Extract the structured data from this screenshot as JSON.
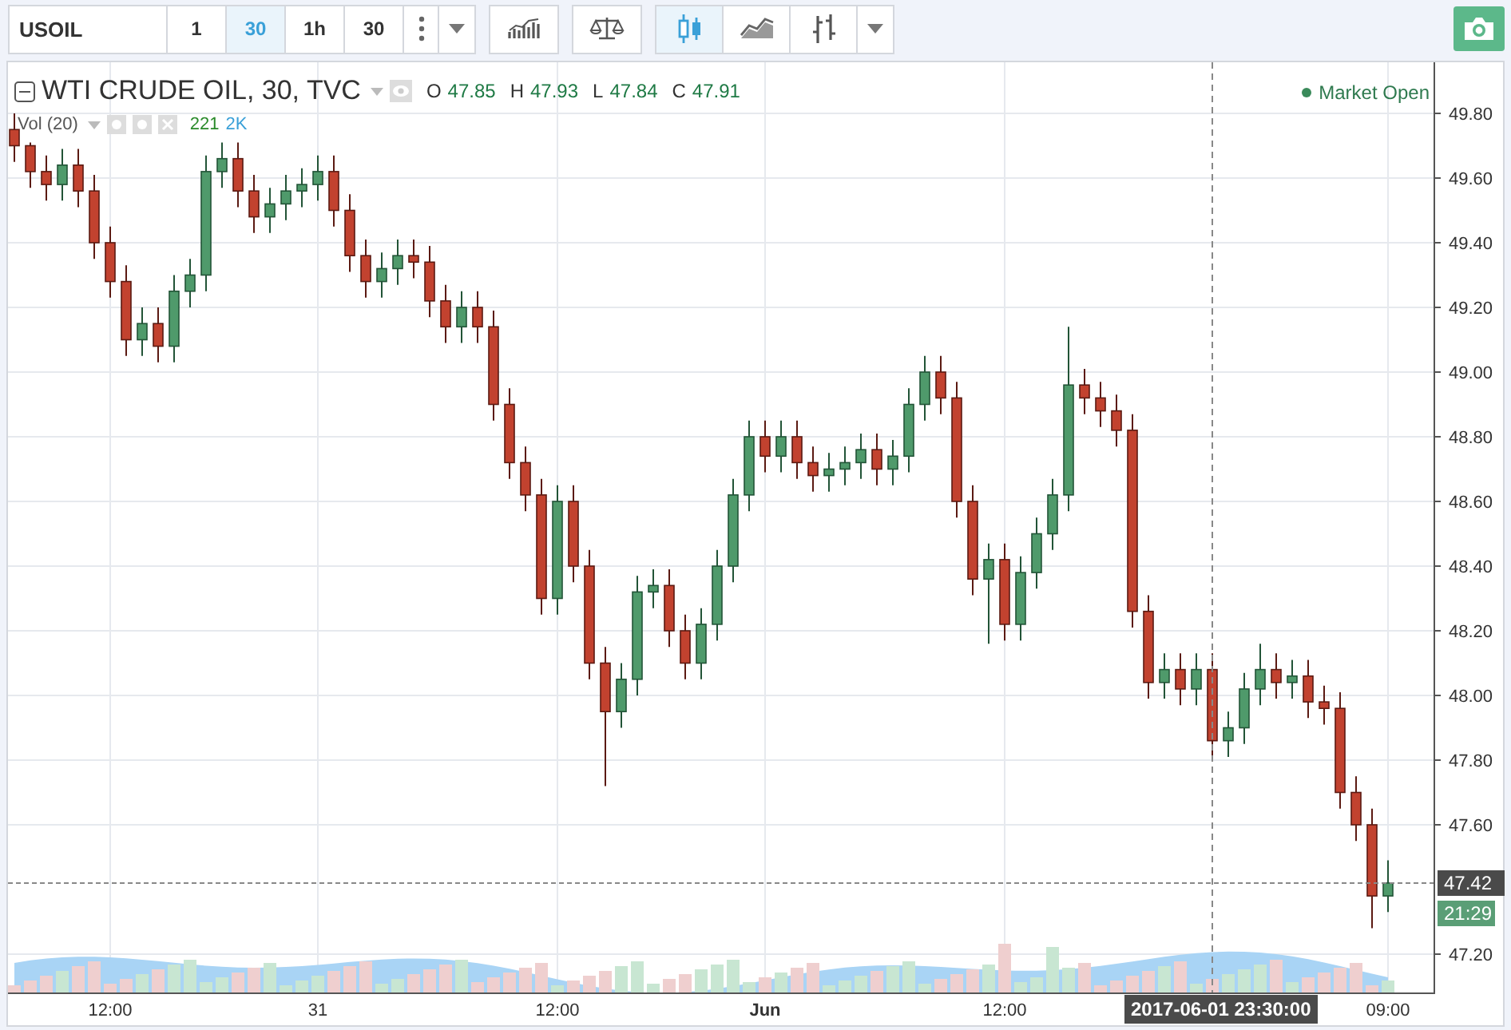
{
  "toolbar": {
    "symbol": "USOIL",
    "intervals": [
      {
        "label": "1",
        "selected": false
      },
      {
        "label": "30",
        "selected": true
      },
      {
        "label": "1h",
        "selected": false
      },
      {
        "label": "30",
        "selected": false
      }
    ],
    "chart_types": [
      {
        "kind": "candles",
        "selected": true
      },
      {
        "kind": "area",
        "selected": false
      },
      {
        "kind": "bars",
        "selected": false
      }
    ]
  },
  "legend": {
    "title": "WTI CRUDE OIL, 30, TVC",
    "ohlc": [
      {
        "label": "O",
        "value": "47.85"
      },
      {
        "label": "H",
        "value": "47.93"
      },
      {
        "label": "L",
        "value": "47.84"
      },
      {
        "label": "C",
        "value": "47.91"
      }
    ],
    "status": "Market Open",
    "volume": {
      "label": "Vol (20)",
      "value": "221",
      "average": "2K"
    }
  },
  "chart": {
    "last_price": "47.42",
    "countdown": "21:29",
    "crosshair_time": "2017-06-01 23:30:00",
    "chart_data": {
      "type": "candlestick",
      "categories": [
        null,
        null,
        null,
        null,
        null,
        null,
        "12:00",
        null,
        null,
        null,
        null,
        null,
        null,
        null,
        null,
        null,
        null,
        null,
        null,
        "31",
        null,
        null,
        null,
        null,
        null,
        null,
        null,
        null,
        null,
        null,
        null,
        null,
        null,
        null,
        "12:00",
        null,
        null,
        null,
        null,
        null,
        null,
        null,
        null,
        null,
        null,
        null,
        null,
        "Jun",
        null,
        null,
        null,
        null,
        null,
        null,
        null,
        null,
        null,
        null,
        null,
        null,
        null,
        null,
        "12:00",
        null,
        null,
        null,
        null,
        null,
        null,
        null,
        null,
        null,
        null,
        null,
        null,
        null,
        null,
        null,
        null,
        null,
        null,
        null,
        null,
        null,
        null,
        null,
        "09:00"
      ],
      "ohlc": [
        [
          49.75,
          49.8,
          49.65,
          49.7
        ],
        [
          49.7,
          49.71,
          49.57,
          49.62
        ],
        [
          49.62,
          49.67,
          49.53,
          49.58
        ],
        [
          49.58,
          49.69,
          49.53,
          49.64
        ],
        [
          49.64,
          49.69,
          49.51,
          49.56
        ],
        [
          49.56,
          49.61,
          49.35,
          49.4
        ],
        [
          49.4,
          49.45,
          49.23,
          49.28
        ],
        [
          49.28,
          49.33,
          49.05,
          49.1
        ],
        [
          49.1,
          49.2,
          49.05,
          49.15
        ],
        [
          49.15,
          49.2,
          49.03,
          49.08
        ],
        [
          49.08,
          49.3,
          49.03,
          49.25
        ],
        [
          49.25,
          49.35,
          49.2,
          49.3
        ],
        [
          49.3,
          49.67,
          49.25,
          49.62
        ],
        [
          49.62,
          49.71,
          49.57,
          49.66
        ],
        [
          49.66,
          49.71,
          49.51,
          49.56
        ],
        [
          49.56,
          49.61,
          49.43,
          49.48
        ],
        [
          49.48,
          49.57,
          49.43,
          49.52
        ],
        [
          49.52,
          49.61,
          49.47,
          49.56
        ],
        [
          49.56,
          49.63,
          49.51,
          49.58
        ],
        [
          49.58,
          49.67,
          49.53,
          49.62
        ],
        [
          49.62,
          49.67,
          49.45,
          49.5
        ],
        [
          49.5,
          49.55,
          49.31,
          49.36
        ],
        [
          49.36,
          49.41,
          49.23,
          49.28
        ],
        [
          49.28,
          49.37,
          49.23,
          49.32
        ],
        [
          49.32,
          49.41,
          49.27,
          49.36
        ],
        [
          49.36,
          49.41,
          49.29,
          49.34
        ],
        [
          49.34,
          49.39,
          49.17,
          49.22
        ],
        [
          49.22,
          49.27,
          49.09,
          49.14
        ],
        [
          49.14,
          49.25,
          49.09,
          49.2
        ],
        [
          49.2,
          49.25,
          49.09,
          49.14
        ],
        [
          49.14,
          49.19,
          48.85,
          48.9
        ],
        [
          48.9,
          48.95,
          48.67,
          48.72
        ],
        [
          48.72,
          48.77,
          48.57,
          48.62
        ],
        [
          48.62,
          48.67,
          48.25,
          48.3
        ],
        [
          48.3,
          48.65,
          48.25,
          48.6
        ],
        [
          48.6,
          48.65,
          48.35,
          48.4
        ],
        [
          48.4,
          48.45,
          48.05,
          48.1
        ],
        [
          48.1,
          48.15,
          47.72,
          47.95
        ],
        [
          47.95,
          48.1,
          47.9,
          48.05
        ],
        [
          48.05,
          48.37,
          48.0,
          48.32
        ],
        [
          48.32,
          48.39,
          48.27,
          48.34
        ],
        [
          48.34,
          48.39,
          48.15,
          48.2
        ],
        [
          48.2,
          48.25,
          48.05,
          48.1
        ],
        [
          48.1,
          48.27,
          48.05,
          48.22
        ],
        [
          48.22,
          48.45,
          48.17,
          48.4
        ],
        [
          48.4,
          48.67,
          48.35,
          48.62
        ],
        [
          48.62,
          48.85,
          48.57,
          48.8
        ],
        [
          48.8,
          48.85,
          48.69,
          48.74
        ],
        [
          48.74,
          48.85,
          48.69,
          48.8
        ],
        [
          48.8,
          48.85,
          48.67,
          48.72
        ],
        [
          48.72,
          48.77,
          48.63,
          48.68
        ],
        [
          48.68,
          48.75,
          48.63,
          48.7
        ],
        [
          48.7,
          48.77,
          48.65,
          48.72
        ],
        [
          48.72,
          48.81,
          48.67,
          48.76
        ],
        [
          48.76,
          48.81,
          48.65,
          48.7
        ],
        [
          48.7,
          48.79,
          48.65,
          48.74
        ],
        [
          48.74,
          48.95,
          48.69,
          48.9
        ],
        [
          48.9,
          49.05,
          48.85,
          49.0
        ],
        [
          49.0,
          49.05,
          48.87,
          48.92
        ],
        [
          48.92,
          48.97,
          48.55,
          48.6
        ],
        [
          48.6,
          48.65,
          48.31,
          48.36
        ],
        [
          48.36,
          48.47,
          48.16,
          48.42
        ],
        [
          48.42,
          48.47,
          48.17,
          48.22
        ],
        [
          48.22,
          48.43,
          48.17,
          48.38
        ],
        [
          48.38,
          48.55,
          48.33,
          48.5
        ],
        [
          48.5,
          48.67,
          48.45,
          48.62
        ],
        [
          48.62,
          49.14,
          48.57,
          48.96
        ],
        [
          48.96,
          49.01,
          48.87,
          48.92
        ],
        [
          48.92,
          48.97,
          48.83,
          48.88
        ],
        [
          48.88,
          48.93,
          48.77,
          48.82
        ],
        [
          48.82,
          48.87,
          48.21,
          48.26
        ],
        [
          48.26,
          48.31,
          47.99,
          48.04
        ],
        [
          48.04,
          48.13,
          47.99,
          48.08
        ],
        [
          48.08,
          48.13,
          47.97,
          48.02
        ],
        [
          48.02,
          48.13,
          47.97,
          48.08
        ],
        [
          48.08,
          48.13,
          47.81,
          47.86
        ],
        [
          47.86,
          47.95,
          47.81,
          47.9
        ],
        [
          47.9,
          48.07,
          47.85,
          48.02
        ],
        [
          48.02,
          48.16,
          47.97,
          48.08
        ],
        [
          48.08,
          48.13,
          47.99,
          48.04
        ],
        [
          48.04,
          48.11,
          47.99,
          48.06
        ],
        [
          48.06,
          48.11,
          47.93,
          47.98
        ],
        [
          47.98,
          48.03,
          47.91,
          47.96
        ],
        [
          47.96,
          48.01,
          47.65,
          47.7
        ],
        [
          47.7,
          47.75,
          47.55,
          47.6
        ],
        [
          47.6,
          47.65,
          47.28,
          47.38
        ],
        [
          47.38,
          47.49,
          47.33,
          47.42
        ]
      ],
      "grid": true,
      "ref_lines": [
        {
          "axis": "y",
          "value": 47.42
        }
      ],
      "ylim": [
        47.079,
        49.958
      ],
      "yticks": [
        {
          "value": 47.2,
          "label": "47.20"
        },
        {
          "value": 47.6,
          "label": "47.60"
        },
        {
          "value": 47.8,
          "label": "47.80"
        },
        {
          "value": 48.0,
          "label": "48.00"
        },
        {
          "value": 48.2,
          "label": "48.20"
        },
        {
          "value": 48.4,
          "label": "48.40"
        },
        {
          "value": 48.6,
          "label": "48.60"
        },
        {
          "value": 48.8,
          "label": "48.80"
        },
        {
          "value": 49.0,
          "label": "49.00"
        },
        {
          "value": 49.2,
          "label": "49.20"
        },
        {
          "value": 49.4,
          "label": "49.40"
        },
        {
          "value": 49.6,
          "label": "49.60"
        },
        {
          "value": 49.8,
          "label": "49.80"
        }
      ]
    }
  }
}
